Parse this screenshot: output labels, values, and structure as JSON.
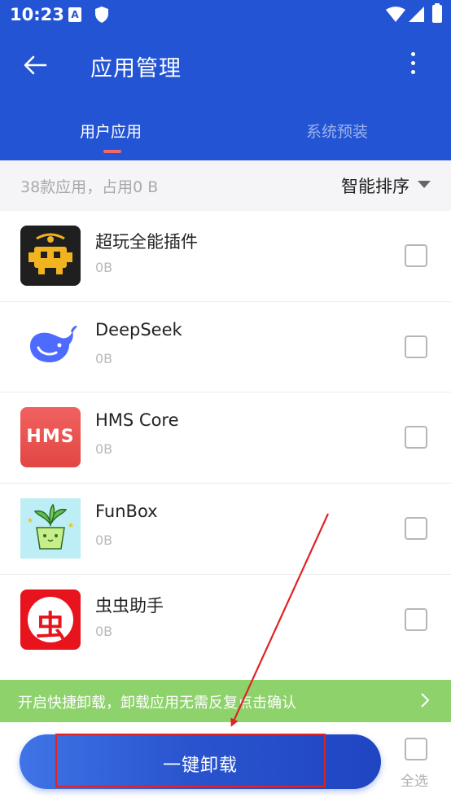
{
  "status_bar": {
    "time": "10:23",
    "app_icon_letter": "A"
  },
  "header": {
    "title": "应用管理"
  },
  "tabs": [
    {
      "label": "用户应用",
      "active": true
    },
    {
      "label": "系统预装",
      "active": false
    }
  ],
  "summary": {
    "text": "38款应用，占用0 B",
    "sort_label": "智能排序"
  },
  "apps": [
    {
      "name": "超玩全能插件",
      "size": "0B",
      "icon": "game-plugin-icon"
    },
    {
      "name": "DeepSeek",
      "size": "0B",
      "icon": "whale-icon"
    },
    {
      "name": "HMS Core",
      "size": "0B",
      "icon": "hms-icon",
      "icon_text": "HMS"
    },
    {
      "name": "FunBox",
      "size": "0B",
      "icon": "plant-pot-icon"
    },
    {
      "name": "虫虫助手",
      "size": "0B",
      "icon": "chongchong-icon",
      "icon_text": "虫"
    }
  ],
  "promo": {
    "text": "开启快捷卸载，卸载应用无需反复点击确认"
  },
  "actions": {
    "uninstall_label": "一键卸载",
    "select_all_label": "全选"
  },
  "colors": {
    "header_blue": "#2354d4",
    "tab_indicator": "#f06a6a",
    "promo_green": "#8ed26c",
    "annotation_red": "#e02323"
  }
}
